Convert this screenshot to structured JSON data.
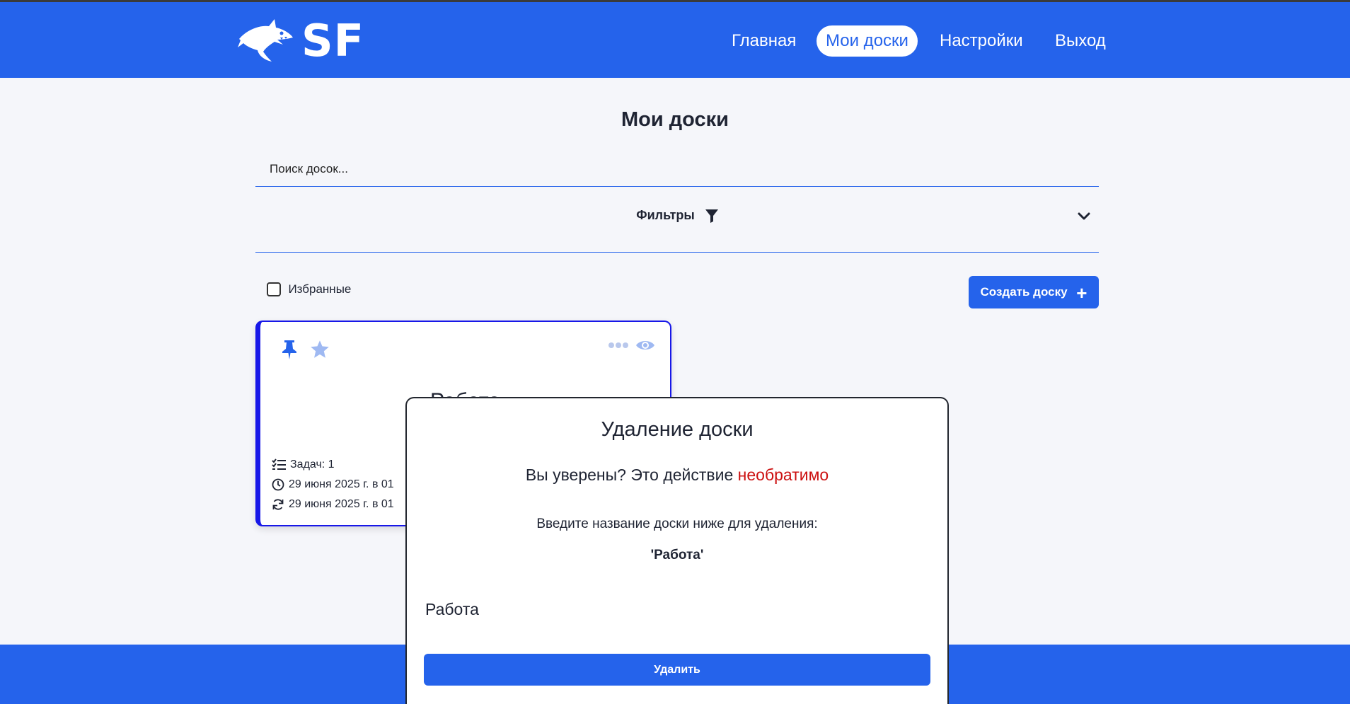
{
  "header": {
    "logo_text": "SF",
    "nav": [
      {
        "label": "Главная",
        "active": false
      },
      {
        "label": "Мои доски",
        "active": true
      },
      {
        "label": "Настройки",
        "active": false
      },
      {
        "label": "Выход",
        "active": false
      }
    ]
  },
  "page": {
    "title": "Мои доски",
    "search_placeholder": "Поиск досок...",
    "filters_label": "Фильтры",
    "favorites_label": "Избранные",
    "favorites_checked": false,
    "create_button": "Создать доску"
  },
  "board_card": {
    "title": "Работа",
    "tasks": "Задач: 1",
    "created": "29 июня 2025 г. в 01",
    "updated": "29 июня 2025 г. в 01",
    "accent_color": "#1717e8"
  },
  "modal": {
    "title": "Удаление доски",
    "warning_prefix": "Вы уверены? Это действие ",
    "warning_emphasis": "необратимо",
    "hint": "Введите название доски ниже для удаления:",
    "board_name": "'Работа'",
    "input_value": "Работа",
    "delete_button": "Удалить"
  },
  "colors": {
    "primary": "#2563eb",
    "danger": "#cc1111",
    "background": "#f5f6fa"
  }
}
